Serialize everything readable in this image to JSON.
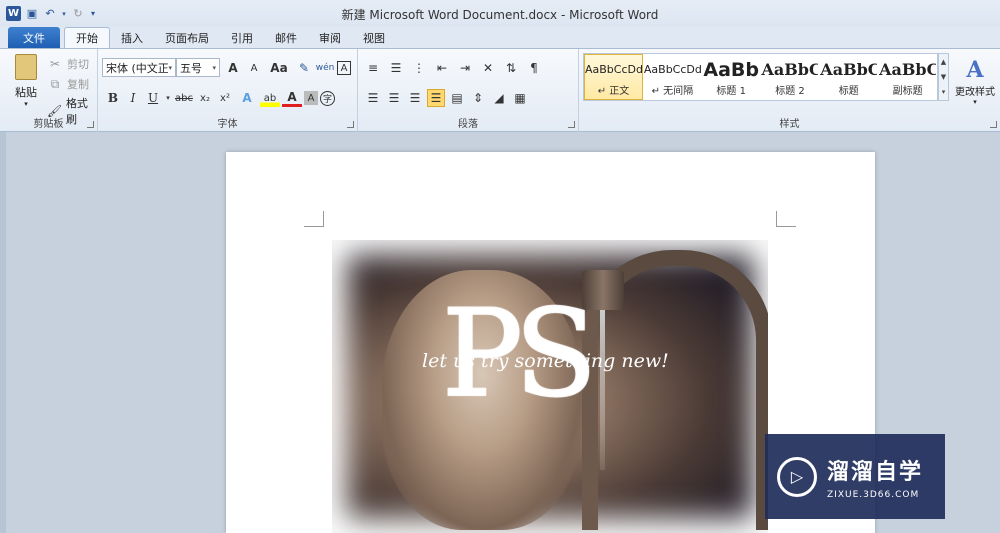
{
  "window": {
    "title": "新建 Microsoft Word Document.docx - Microsoft Word"
  },
  "tabs": [
    "文件",
    "开始",
    "插入",
    "页面布局",
    "引用",
    "邮件",
    "审阅",
    "视图"
  ],
  "clipboard": {
    "paste": "粘贴",
    "cut": "剪切",
    "copy": "复制",
    "format_painter": "格式刷",
    "label": "剪贴板"
  },
  "font": {
    "family": "宋体 (中文正:",
    "size": "五号",
    "label": "字体",
    "grow": "A",
    "shrink": "A",
    "case": "Aa",
    "bold": "B",
    "italic": "I",
    "underline": "U",
    "strike": "abc",
    "sub": "x₂",
    "sup": "x²",
    "phonetic": "wén",
    "border_char": "A",
    "color_a": "A",
    "highlight": "ab",
    "shade": "A",
    "circle": "字"
  },
  "paragraph": {
    "label": "段落"
  },
  "styles": {
    "label": "样式",
    "change": "更改样式",
    "items": [
      {
        "sample": "AaBbCcDd",
        "name": "↵ 正文"
      },
      {
        "sample": "AaBbCcDd",
        "name": "↵ 无间隔"
      },
      {
        "sample": "AaBb",
        "name": "标题 1"
      },
      {
        "sample": "AaBbC",
        "name": "标题 2"
      },
      {
        "sample": "AaBbC",
        "name": "标题"
      },
      {
        "sample": "AaBbC",
        "name": "副标题"
      }
    ]
  },
  "document": {
    "logo": "PS",
    "tagline": "let us try something new!"
  },
  "watermark": {
    "brand": "溜溜自学",
    "url": "ZIXUE.3D66.COM"
  }
}
